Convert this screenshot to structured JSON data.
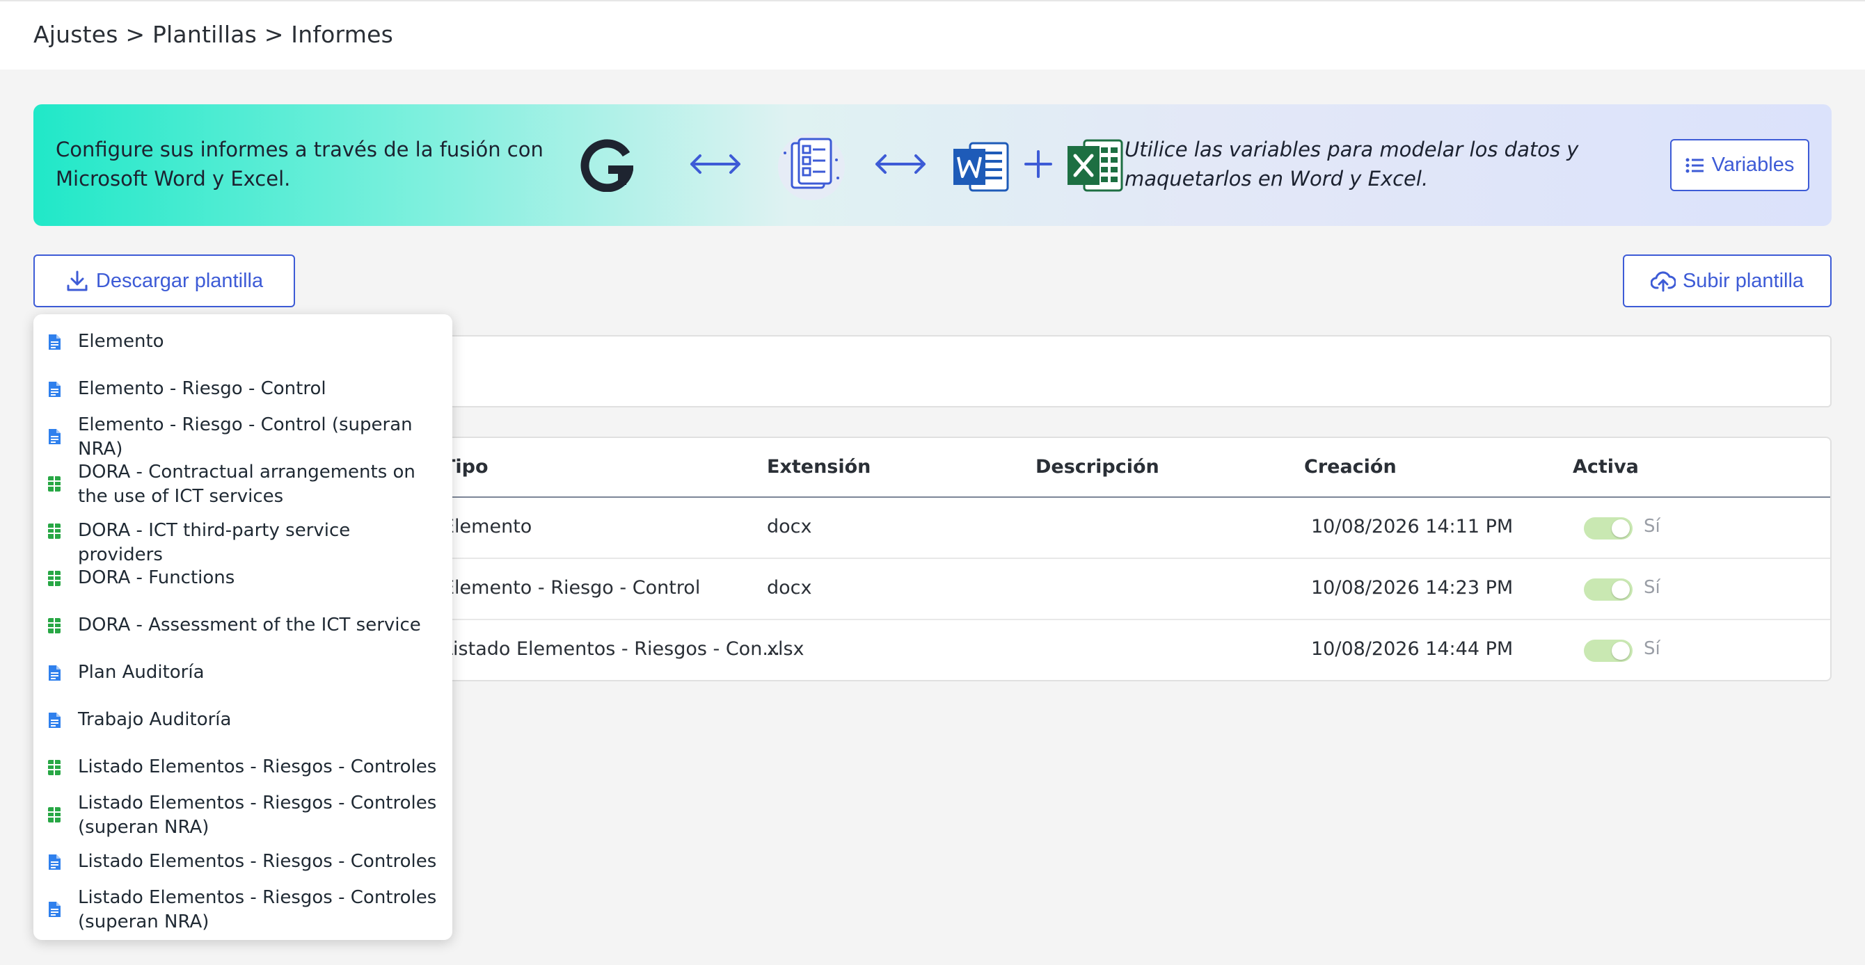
{
  "breadcrumb": [
    "Ajustes",
    "Plantillas",
    "Informes"
  ],
  "breadcrumb_separator": ">",
  "banner": {
    "left_text": "Configure sus informes a través de la fusión con Microsoft Word y Excel.",
    "right_text": "Utilice las variables para modelar los datos y maquetarlos en Word y Excel.",
    "variables_button": "Variables"
  },
  "toolbar": {
    "download_label": "Descargar plantilla",
    "upload_label": "Subir plantilla"
  },
  "dropdown": {
    "items": [
      {
        "label": "Elemento",
        "icon": "word-doc-icon"
      },
      {
        "label": "Elemento - Riesgo - Control",
        "icon": "word-doc-icon"
      },
      {
        "label": "Elemento - Riesgo - Control (superan NRA)",
        "icon": "word-doc-icon"
      },
      {
        "label": "DORA - Contractual arrangements on the use of ICT services",
        "icon": "excel-sheet-icon"
      },
      {
        "label": "DORA - ICT third-party service providers",
        "icon": "excel-sheet-icon"
      },
      {
        "label": "DORA - Functions",
        "icon": "excel-sheet-icon"
      },
      {
        "label": "DORA - Assessment of the ICT service",
        "icon": "excel-sheet-icon"
      },
      {
        "label": "Plan Auditoría",
        "icon": "word-doc-icon"
      },
      {
        "label": "Trabajo Auditoría",
        "icon": "word-doc-icon"
      },
      {
        "label": "Listado Elementos - Riesgos - Controles",
        "icon": "excel-sheet-icon"
      },
      {
        "label": "Listado Elementos - Riesgos - Controles (superan NRA)",
        "icon": "excel-sheet-icon"
      },
      {
        "label": "Listado Elementos - Riesgos - Controles",
        "icon": "word-doc-icon"
      },
      {
        "label": "Listado Elementos - Riesgos - Controles (superan NRA)",
        "icon": "word-doc-icon"
      }
    ]
  },
  "table": {
    "headers": {
      "tipo": "Tipo",
      "extension": "Extensión",
      "descripcion": "Descripción",
      "creacion": "Creación",
      "activa": "Activa"
    },
    "rows": [
      {
        "tipo": "Elemento",
        "extension": "docx",
        "descripcion": "",
        "creacion": "10/08/2026 14:11 PM",
        "activa": "Sí"
      },
      {
        "tipo": "Elemento - Riesgo - Control",
        "extension": "docx",
        "descripcion": "",
        "creacion": "10/08/2026 14:23 PM",
        "activa": "Sí"
      },
      {
        "tipo": "Listado Elementos - Riesgos - Con...",
        "extension": "xlsx",
        "descripcion": "",
        "creacion": "10/08/2026 14:44 PM",
        "activa": "Sí"
      }
    ]
  },
  "colors": {
    "accent": "#3d5bd6",
    "word_icon": "#2f80ed",
    "excel_icon": "#28a745",
    "toggle_on": "#c9e8b2"
  }
}
